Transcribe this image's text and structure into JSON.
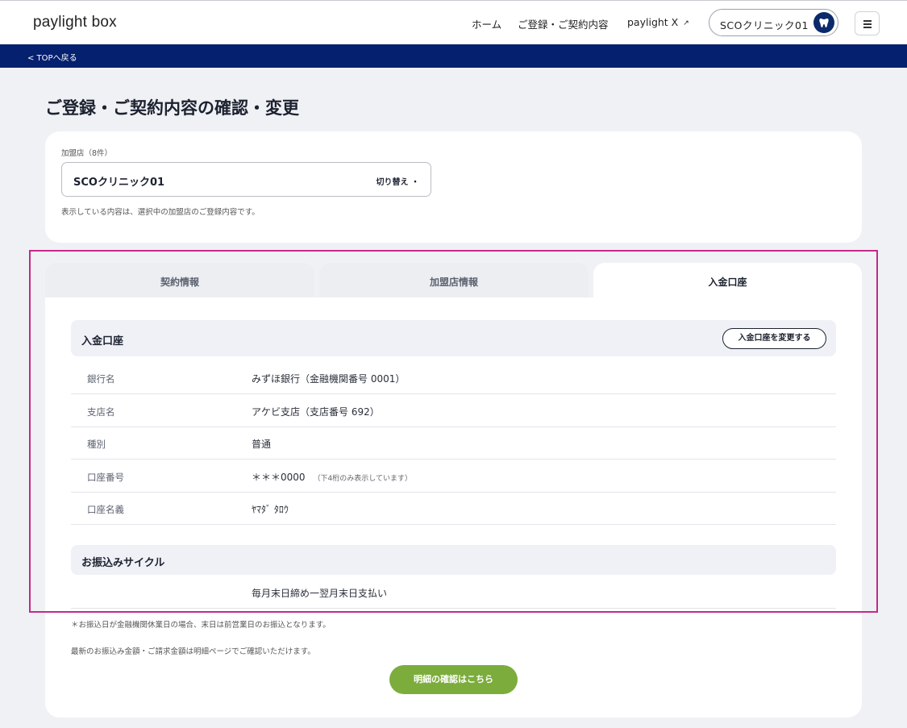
{
  "header": {
    "logo": "paylight box",
    "nav_home": "ホーム",
    "nav_contract": "ご登録・ご契約内容",
    "nav_paylight_x": "paylight X",
    "user_label": "SCOクリニック01"
  },
  "topbar": {
    "back_label": "< TOPへ戻る"
  },
  "page": {
    "title": "ご登録・ご契約内容の確認・変更"
  },
  "store": {
    "caption": "加盟店（8件）",
    "selected": "SCOクリニック01",
    "switch_label": "切り替え ・",
    "note": "表示している内容は、選択中の加盟店のご登録内容です。"
  },
  "tabs": [
    {
      "label": "契約情報",
      "active": false
    },
    {
      "label": "加盟店情報",
      "active": false
    },
    {
      "label": "入金口座",
      "active": true
    }
  ],
  "account": {
    "section_title": "入金口座",
    "change_button": "入金口座を変更する",
    "rows": [
      {
        "label": "銀行名",
        "value": "みずほ銀行（金融機関番号 0001）"
      },
      {
        "label": "支店名",
        "value": "アケビ支店（支店番号 692）"
      },
      {
        "label": "種別",
        "value": "普通"
      },
      {
        "label": "口座番号",
        "value": "＊＊＊0000",
        "note": "（下4桁のみ表示しています）"
      },
      {
        "label": "口座名義",
        "value": "ﾔﾏﾀﾞ ﾀﾛｳ"
      }
    ]
  },
  "cycle": {
    "section_title": "お振込みサイクル",
    "value": "毎月末日締め一翌月末日支払い"
  },
  "footer": {
    "note1": "＊お振込日が金融機関休業日の場合、末日は前営業日のお振込となります。",
    "note2": "最新のお振込み金額・ご請求金額は明細ページでご確認いただけます。",
    "detail_button": "明細の確認はこちら"
  },
  "colors": {
    "navy": "#062070",
    "accent_green": "#7cad3c",
    "highlight": "#c5288c"
  }
}
